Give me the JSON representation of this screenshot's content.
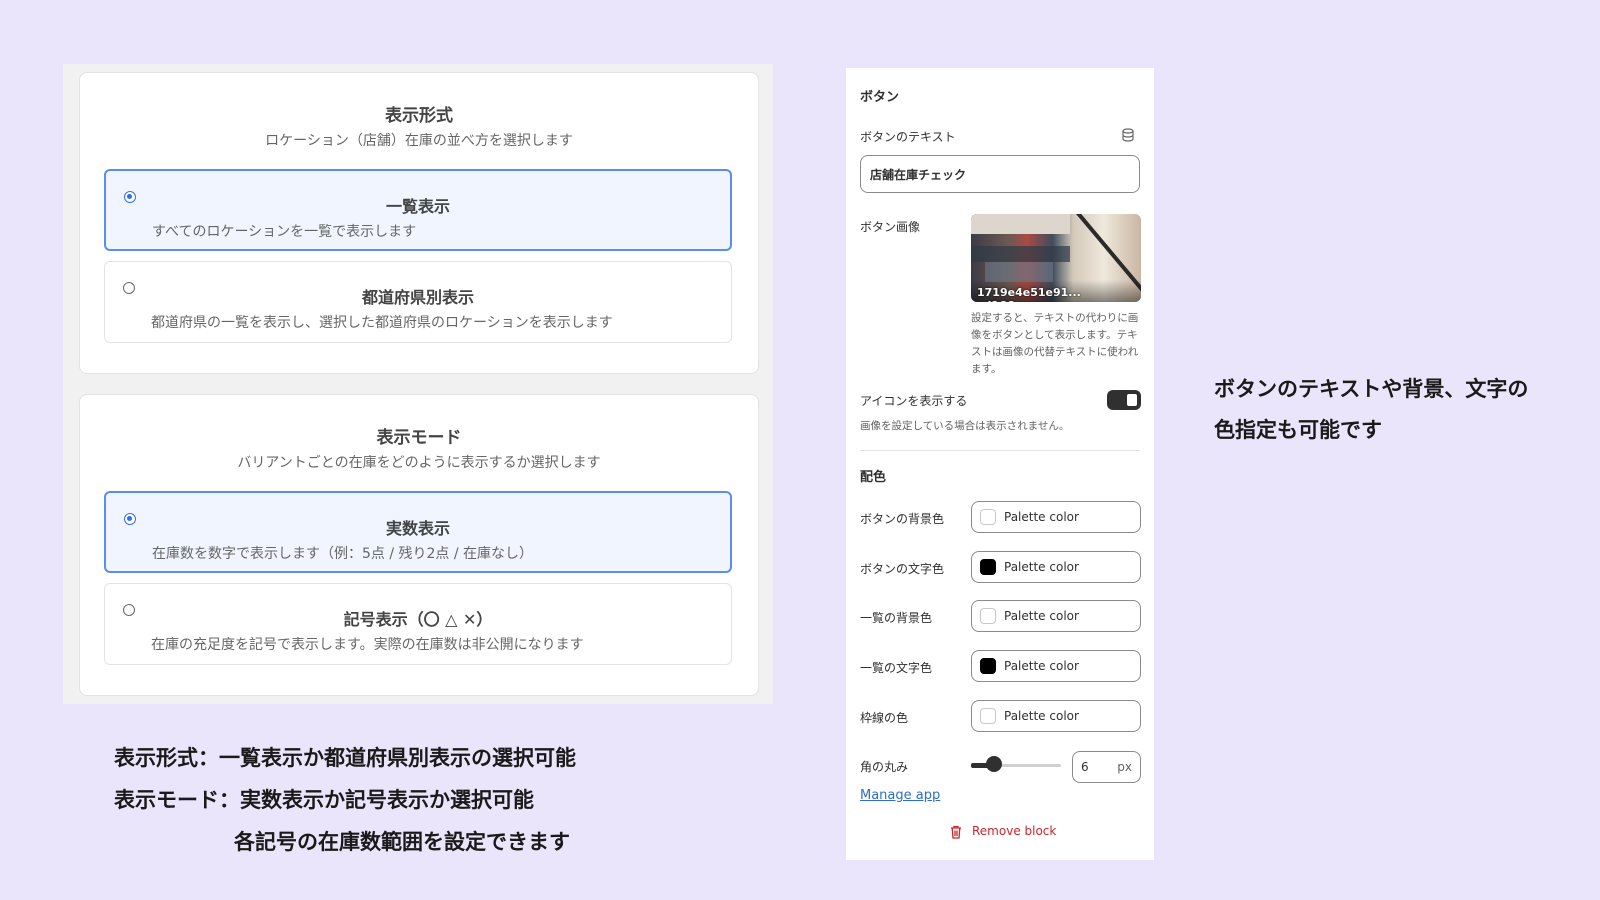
{
  "display_format_card": {
    "title": "表示形式",
    "subtitle": "ロケーション（店舗）在庫の並べ方を選択します",
    "options": [
      {
        "label": "一覧表示",
        "description": "すべてのロケーションを一覧で表示します",
        "selected": true
      },
      {
        "label": "都道府県別表示",
        "description": "都道府県の一覧を表示し、選択した都道府県のロケーションを表示します",
        "selected": false
      }
    ]
  },
  "display_mode_card": {
    "title": "表示モード",
    "subtitle": "バリアントごとの在庫をどのように表示するか選択します",
    "options": [
      {
        "label": "実数表示",
        "description": "在庫数を数字で表示します（例：5点 / 残り2点 / 在庫なし）",
        "selected": true
      },
      {
        "label": "記号表示（〇 △ ✕）",
        "description": "在庫の充足度を記号で表示します。実際の在庫数は非公開になります",
        "selected": false
      }
    ]
  },
  "captions": {
    "line1": "表示形式：一覧表示か都道府県別表示の選択可能",
    "line2": "表示モード：実数表示か記号表示か選択可能",
    "line3": "各記号の在庫数範囲を設定できます"
  },
  "block_settings": {
    "section_button": "ボタン",
    "button_text_label": "ボタンのテキスト",
    "button_text_value": "店舗在庫チェック",
    "button_image_label": "ボタン画像",
    "image_filename": "1719e4e51e91... cd166.png",
    "image_help": "設定すると、テキストの代わりに画像をボタンとして表示します。テキストは画像の代替テキストに使われます。",
    "show_icon_label": "アイコンを表示する",
    "show_icon_enabled": true,
    "show_icon_help": "画像を設定している場合は表示されません。",
    "section_colors": "配色",
    "color_fields": [
      {
        "label": "ボタンの背景色",
        "value": "Palette color",
        "swatch": "#ffffff"
      },
      {
        "label": "ボタンの文字色",
        "value": "Palette color",
        "swatch": "#000000"
      },
      {
        "label": "一覧の背景色",
        "value": "Palette color",
        "swatch": "#ffffff"
      },
      {
        "label": "一覧の文字色",
        "value": "Palette color",
        "swatch": "#000000"
      },
      {
        "label": "枠線の色",
        "value": "Palette color",
        "swatch": "#ffffff"
      }
    ],
    "corner_radius_label": "角の丸み",
    "corner_radius_value": "6",
    "corner_radius_unit": "px",
    "corner_radius_level": 0.25,
    "manage_app": "Manage app",
    "remove_block": "Remove block"
  },
  "note": {
    "line1": "ボタンのテキストや背景、文字の",
    "line2": "色指定も可能です"
  }
}
